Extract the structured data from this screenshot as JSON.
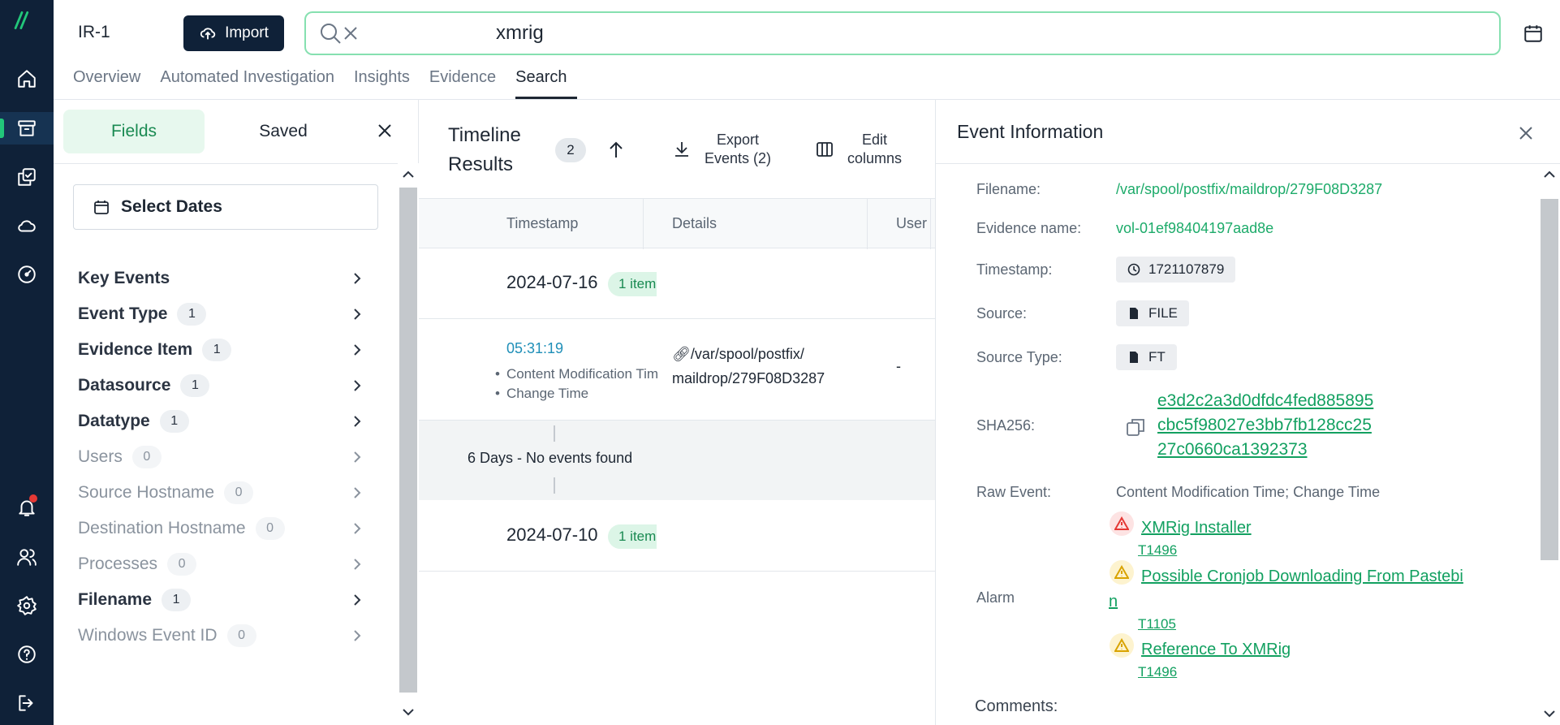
{
  "case": {
    "name": "IR-1"
  },
  "toolbar": {
    "import_label": "Import"
  },
  "search": {
    "value": "xmrig"
  },
  "tabs": [
    {
      "label": "Overview"
    },
    {
      "label": "Automated Investigation"
    },
    {
      "label": "Insights"
    },
    {
      "label": "Evidence"
    },
    {
      "label": "Search"
    }
  ],
  "left_panel": {
    "tab_fields": "Fields",
    "tab_saved": "Saved",
    "select_dates": "Select Dates",
    "filters": [
      {
        "label": "Key Events",
        "count": ""
      },
      {
        "label": "Event Type",
        "count": "1"
      },
      {
        "label": "Evidence Item",
        "count": "1"
      },
      {
        "label": "Datasource",
        "count": "1"
      },
      {
        "label": "Datatype",
        "count": "1"
      },
      {
        "label": "Users",
        "count": "0"
      },
      {
        "label": "Source Hostname",
        "count": "0"
      },
      {
        "label": "Destination Hostname",
        "count": "0"
      },
      {
        "label": "Processes",
        "count": "0"
      },
      {
        "label": "Filename",
        "count": "1"
      },
      {
        "label": "Windows Event ID",
        "count": "0"
      }
    ]
  },
  "timeline": {
    "title_line1": "Timeline",
    "title_line2": "Results",
    "count": "2",
    "export_line1": "Export",
    "export_line2": "Events (2)",
    "edit_line1": "Edit",
    "edit_line2": "columns",
    "columns": {
      "timestamp": "Timestamp",
      "details": "Details",
      "user": "User"
    },
    "groups": [
      {
        "date": "2024-07-16",
        "items": "1 item"
      },
      {
        "date": "2024-07-10",
        "items": "1 item"
      }
    ],
    "event": {
      "time": "05:31:19",
      "bullet1": "Content Modification Time",
      "bullet2": "Change Time",
      "path_line1": "/var/spool/postfix/",
      "path_line2": "maildrop/279F08D3287",
      "user": "-"
    },
    "gap_text": "6 Days - No events found"
  },
  "event_info": {
    "title": "Event Information",
    "filename_label": "Filename:",
    "filename": "/var/spool/postfix/maildrop/279F08D3287",
    "evidence_label": "Evidence name:",
    "evidence": "vol-01ef98404197aad8e",
    "timestamp_label": "Timestamp:",
    "timestamp": "1721107879",
    "source_label": "Source:",
    "source": "FILE",
    "source_type_label": "Source Type:",
    "source_type": "FT",
    "sha_label": "SHA256:",
    "sha_line1": "e3d2c2a3d0dfdc4fed885895",
    "sha_line2": "cbc5f98027e3bb7fb128cc25",
    "sha_line3": "27c0660ca1392373",
    "raw_label": "Raw Event:",
    "raw": "Content Modification Time; Change Time",
    "alarm_label": "Alarm",
    "alarms": [
      {
        "name": "XMRig Installer",
        "technique": "T1496",
        "severity": "high"
      },
      {
        "name_line1": "Possible Cronjob Downloading From Pastebi",
        "name_line2": "n",
        "technique": "T1105",
        "severity": "medium"
      },
      {
        "name": "Reference To XMRig",
        "technique": "T1496",
        "severity": "medium"
      }
    ],
    "comments_label": "Comments:"
  },
  "colors": {
    "accent": "#1dab6a",
    "rail": "#0f2138",
    "alarm_high": "#e53935",
    "alarm_medium": "#d9a300"
  }
}
